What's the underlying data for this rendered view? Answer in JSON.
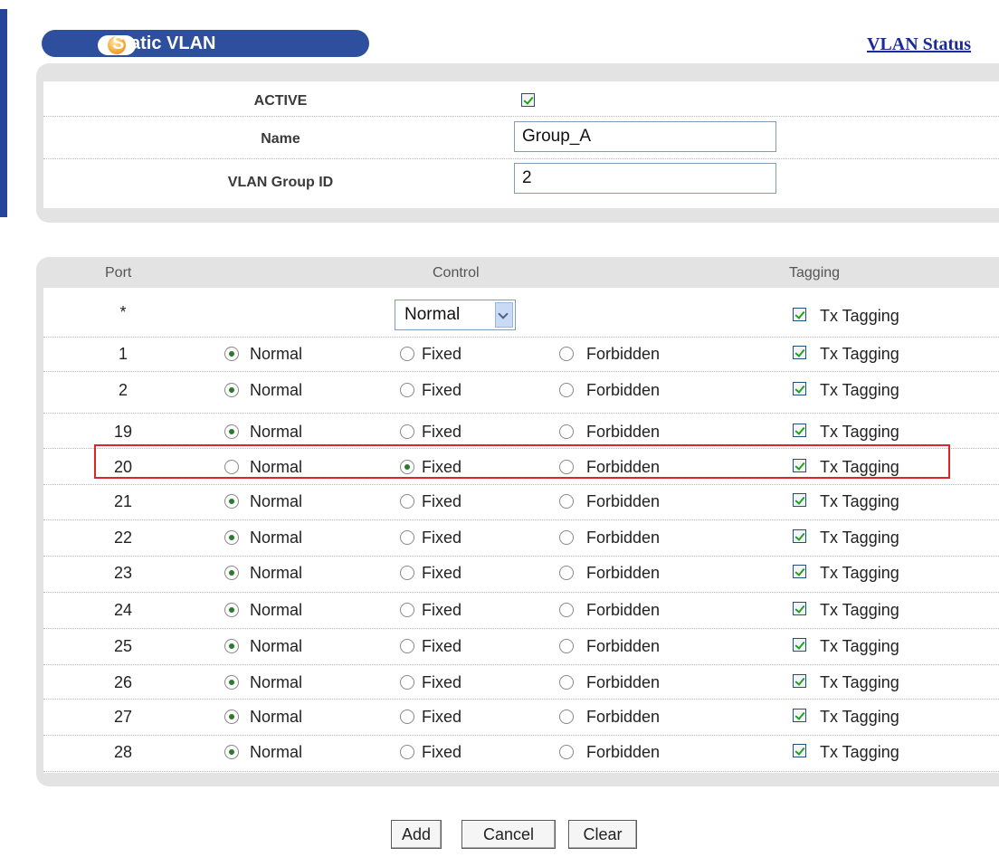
{
  "header": {
    "title": "Static VLAN",
    "status_link": "VLAN Status"
  },
  "form": {
    "active_label": "ACTIVE",
    "active_checked": true,
    "name_label": "Name",
    "name_value": "Group_A",
    "vlan_id_label": "VLAN Group ID",
    "vlan_id_value": "2"
  },
  "table": {
    "col_port": "Port",
    "col_control": "Control",
    "col_tagging": "Tagging",
    "all_row": {
      "port": "*",
      "control_select": "Normal",
      "tagging_label": "Tx Tagging"
    },
    "option_labels": [
      "Normal",
      "Fixed",
      "Forbidden"
    ],
    "tagging_label": "Tx Tagging",
    "rows": [
      {
        "port": "1",
        "control": "Normal"
      },
      {
        "port": "2",
        "control": "Normal"
      },
      {
        "port": "19",
        "control": "Normal"
      },
      {
        "port": "20",
        "control": "Fixed",
        "highlighted": true
      },
      {
        "port": "21",
        "control": "Normal"
      },
      {
        "port": "22",
        "control": "Normal"
      },
      {
        "port": "23",
        "control": "Normal"
      },
      {
        "port": "24",
        "control": "Normal"
      },
      {
        "port": "25",
        "control": "Normal"
      },
      {
        "port": "26",
        "control": "Normal"
      },
      {
        "port": "27",
        "control": "Normal"
      },
      {
        "port": "28",
        "control": "Normal"
      }
    ]
  },
  "buttons": {
    "add": "Add",
    "cancel": "Cancel",
    "clear": "Clear"
  },
  "colors": {
    "title_bar": "#2d4f9e",
    "link": "#1a2a9a",
    "highlight": "#d8262a",
    "panel": "#e3e3e3"
  }
}
